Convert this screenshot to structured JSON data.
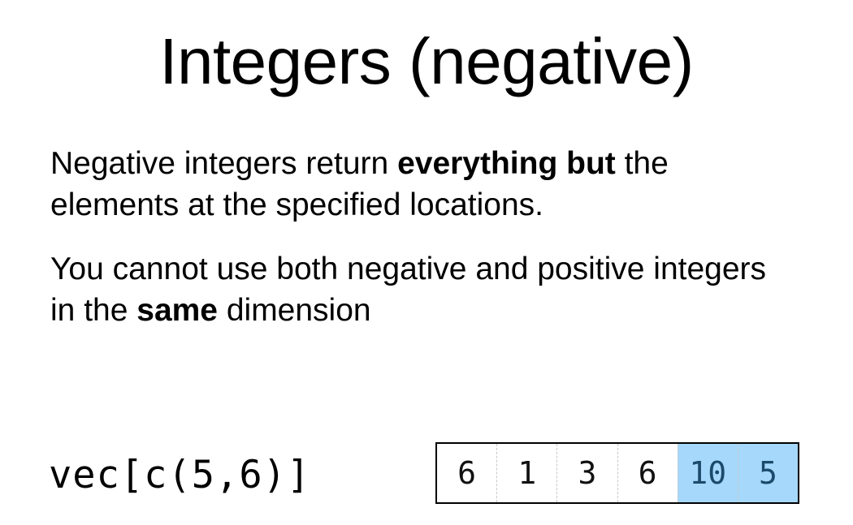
{
  "title": "Integers (negative)",
  "paragraph1": {
    "before": "Negative integers return ",
    "bold": "everything but",
    "after": " the elements at the specified locations."
  },
  "paragraph2": {
    "before": "You cannot use both negative and positive integers in the ",
    "bold": "same",
    "after": " dimension"
  },
  "code": "vec[c(5,6)]",
  "vector": {
    "values": [
      "6",
      "1",
      "3",
      "6",
      "10",
      "5"
    ],
    "highlight_color": "#a6d8fb"
  }
}
